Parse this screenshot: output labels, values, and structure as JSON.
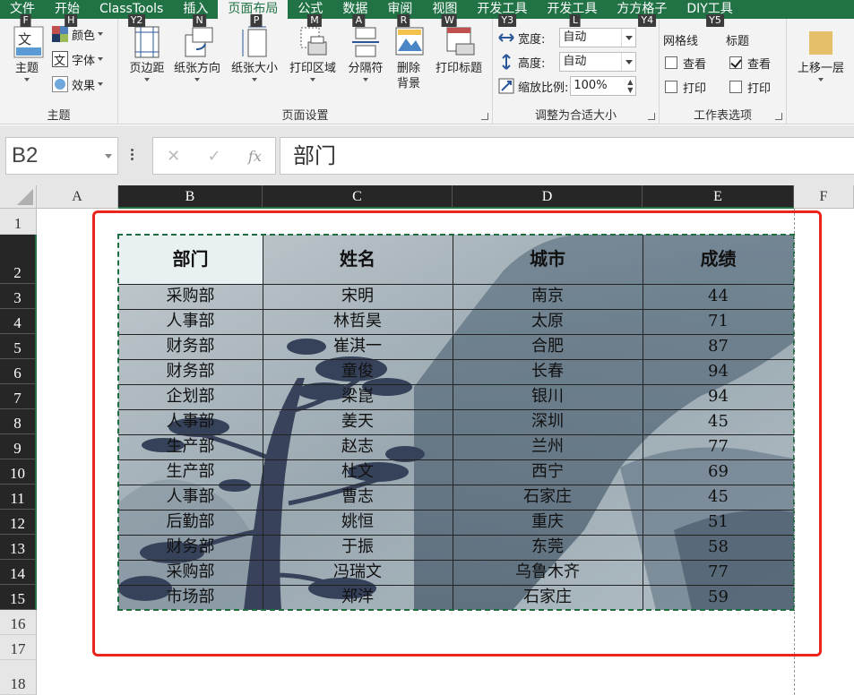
{
  "menubar": {
    "tabs": [
      {
        "label": "文件",
        "key": "F"
      },
      {
        "label": "开始",
        "key": "H"
      },
      {
        "label": "ClassTools",
        "key": "Y2"
      },
      {
        "label": "插入",
        "key": "N"
      },
      {
        "label": "页面布局",
        "key": "P",
        "active": true
      },
      {
        "label": "公式",
        "key": "M"
      },
      {
        "label": "数据",
        "key": "A"
      },
      {
        "label": "审阅",
        "key": "R"
      },
      {
        "label": "视图",
        "key": "W"
      },
      {
        "label": "开发工具",
        "key": "Y3"
      },
      {
        "label": "开发工具",
        "key": "L"
      },
      {
        "label": "方方格子",
        "key": "Y4"
      },
      {
        "label": "DIY工具",
        "key": "Y5"
      }
    ]
  },
  "ribbon": {
    "theme_group": {
      "label": "主题",
      "theme_btn": "主题",
      "colors": "颜色",
      "fonts": "字体",
      "effects": "效果"
    },
    "page_setup_group": {
      "label": "页面设置",
      "margins": "页边距",
      "orientation": "纸张方向",
      "size": "纸张大小",
      "print_area": "打印区域",
      "breaks": "分隔符",
      "delete_bg_1": "删除",
      "delete_bg_2": "背景",
      "print_titles": "打印标题"
    },
    "scale_group": {
      "label": "调整为合适大小",
      "width_label": "宽度:",
      "width_value": "自动",
      "height_label": "高度:",
      "height_value": "自动",
      "scale_label": "缩放比例:",
      "scale_value": "100%"
    },
    "sheet_options_group": {
      "label": "工作表选项",
      "gridlines": "网格线",
      "headings": "标题",
      "view": "查看",
      "print": "打印"
    },
    "arrange_group": {
      "bring_forward": "上移一层"
    }
  },
  "formula_bar": {
    "name_box": "B2",
    "cancel": "✕",
    "enter": "✓",
    "fx": "fx",
    "content": "部门"
  },
  "sheet": {
    "columns": [
      "A",
      "B",
      "C",
      "D",
      "E",
      "F"
    ],
    "rows": [
      "1",
      "2",
      "3",
      "4",
      "5",
      "6",
      "7",
      "8",
      "9",
      "10",
      "11",
      "12",
      "13",
      "14",
      "15",
      "16",
      "17",
      "18"
    ],
    "headers": [
      "部门",
      "姓名",
      "城市",
      "成绩"
    ],
    "records": [
      [
        "采购部",
        "宋明",
        "南京",
        "44"
      ],
      [
        "人事部",
        "林哲昊",
        "太原",
        "71"
      ],
      [
        "财务部",
        "崔淇一",
        "合肥",
        "87"
      ],
      [
        "财务部",
        "童俊",
        "长春",
        "94"
      ],
      [
        "企划部",
        "梁崑",
        "银川",
        "94"
      ],
      [
        "人事部",
        "姜天",
        "深圳",
        "45"
      ],
      [
        "生产部",
        "赵志",
        "兰州",
        "77"
      ],
      [
        "生产部",
        "杜文",
        "西宁",
        "69"
      ],
      [
        "人事部",
        "曹志",
        "石家庄",
        "45"
      ],
      [
        "后勤部",
        "姚恒",
        "重庆",
        "51"
      ],
      [
        "财务部",
        "于振",
        "东莞",
        "58"
      ],
      [
        "采购部",
        "冯瑞文",
        "乌鲁木齐",
        "77"
      ],
      [
        "市场部",
        "郑洋",
        "石家庄",
        "59"
      ]
    ]
  },
  "colors": {
    "excel_green": "#217346",
    "highlight_red": "#e8261f"
  }
}
